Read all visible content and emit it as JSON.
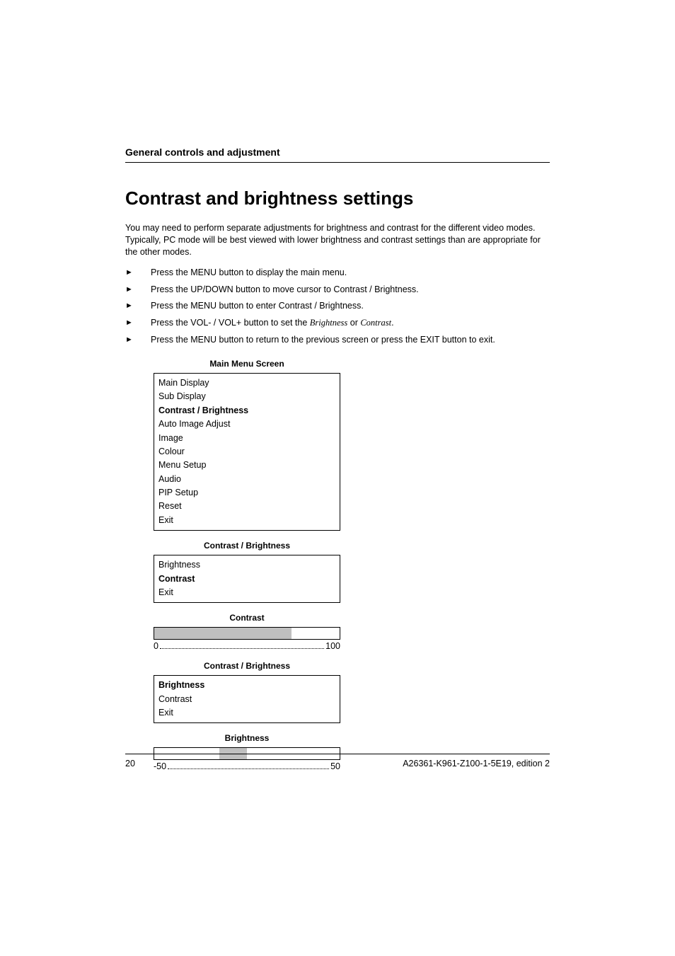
{
  "header": {
    "section": "General controls and adjustment"
  },
  "title": "Contrast and brightness settings",
  "intro": "You may need to perform separate adjustments for brightness and contrast for the different video modes. Typically, PC mode will be best viewed with lower brightness and contrast settings than are appropriate for the other modes.",
  "steps": [
    {
      "text": "Press the MENU button to display the main menu."
    },
    {
      "text": "Press the UP/DOWN button to move cursor to Contrast / Brightness."
    },
    {
      "text": "Press the MENU button to enter Contrast / Brightness."
    },
    {
      "prefix": "Press the VOL- / VOL+ button to set the ",
      "italic1": "Brightness",
      "mid": " or ",
      "italic2": "Contrast",
      "suffix": "."
    },
    {
      "text": "Press the MENU button to return to the previous screen or press the EXIT button to exit."
    }
  ],
  "mainMenu": {
    "title": "Main Menu Screen",
    "items": [
      {
        "label": "Main Display",
        "bold": false
      },
      {
        "label": "Sub Display",
        "bold": false
      },
      {
        "label": "Contrast / Brightness",
        "bold": true
      },
      {
        "label": "Auto Image Adjust",
        "bold": false
      },
      {
        "label": "Image",
        "bold": false
      },
      {
        "label": "Colour",
        "bold": false
      },
      {
        "label": "Menu Setup",
        "bold": false
      },
      {
        "label": "Audio",
        "bold": false
      },
      {
        "label": "PIP Setup",
        "bold": false
      },
      {
        "label": "Reset",
        "bold": false
      },
      {
        "label": "Exit",
        "bold": false
      }
    ]
  },
  "subMenu1": {
    "title": "Contrast / Brightness",
    "items": [
      {
        "label": "Brightness",
        "bold": false
      },
      {
        "label": "Contrast",
        "bold": true
      },
      {
        "label": "Exit",
        "bold": false
      }
    ]
  },
  "slider1": {
    "title": "Contrast",
    "min": "0",
    "max": "100",
    "percent": 74
  },
  "subMenu2": {
    "title": "Contrast / Brightness",
    "items": [
      {
        "label": "Brightness",
        "bold": true
      },
      {
        "label": "Contrast",
        "bold": false
      },
      {
        "label": "Exit",
        "bold": false
      }
    ]
  },
  "slider2": {
    "title": "Brightness",
    "min": "-50",
    "max": "50",
    "percent_left": 35,
    "percent_width": 15
  },
  "footer": {
    "page": "20",
    "docid": "A26361-K961-Z100-1-5E19, edition 2"
  }
}
